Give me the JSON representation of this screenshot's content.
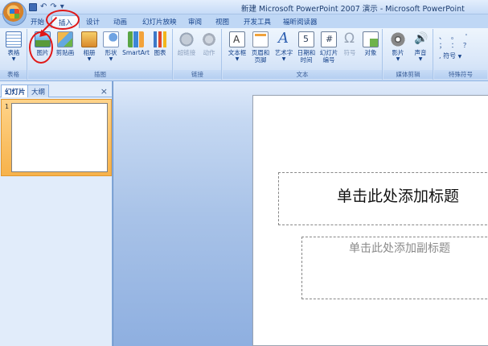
{
  "window": {
    "title": "新建 Microsoft PowerPoint 2007 演示 - Microsoft PowerPoint"
  },
  "quick_access": {
    "undo_glyph": "↶",
    "redo_glyph": "↷",
    "more_glyph": "▾"
  },
  "tabs": [
    {
      "label": "开始"
    },
    {
      "label": "插入",
      "active": true
    },
    {
      "label": "设计"
    },
    {
      "label": "动画"
    },
    {
      "label": "幻灯片放映"
    },
    {
      "label": "审阅"
    },
    {
      "label": "视图"
    },
    {
      "label": "开发工具"
    },
    {
      "label": "福昕阅读器"
    }
  ],
  "ribbon": {
    "groups": {
      "tables": "表格",
      "illustrations": "插图",
      "links": "链接",
      "text": "文本",
      "media": "媒体剪辑",
      "special": "特殊符号"
    },
    "tools": {
      "table": "表格",
      "picture": "图片",
      "clipart": "剪贴画",
      "album": "相册",
      "shapes": "形状",
      "smartart": "SmartArt",
      "chart": "图表",
      "hyperlink": "超链接",
      "action": "动作",
      "textbox": "文本框",
      "headerfooter_1": "页眉和",
      "headerfooter_2": "页脚",
      "wordart": "艺术字",
      "datetime_1": "日期和",
      "datetime_2": "时间",
      "slidenum_1": "幻灯片",
      "slidenum_2": "编号",
      "symbol": "符号",
      "object": "对象",
      "movie": "影片",
      "sound": "声音"
    },
    "special_symbols": {
      "row1": [
        "、",
        "。",
        "'"
      ],
      "row2": [
        "；",
        "：",
        "？"
      ],
      "symbol_label": "符号"
    }
  },
  "slides_pane": {
    "tab_slides": "幻灯片",
    "tab_outline": "大纲",
    "close": "×",
    "thumbnails": [
      {
        "number": "1"
      }
    ]
  },
  "slide": {
    "title_placeholder": "单击此处添加标题",
    "subtitle_placeholder": "单击此处添加副标题"
  },
  "colors": {
    "accent": "#15428b",
    "annotation": "#e01818",
    "selected_thumb": "#f7b24a"
  }
}
